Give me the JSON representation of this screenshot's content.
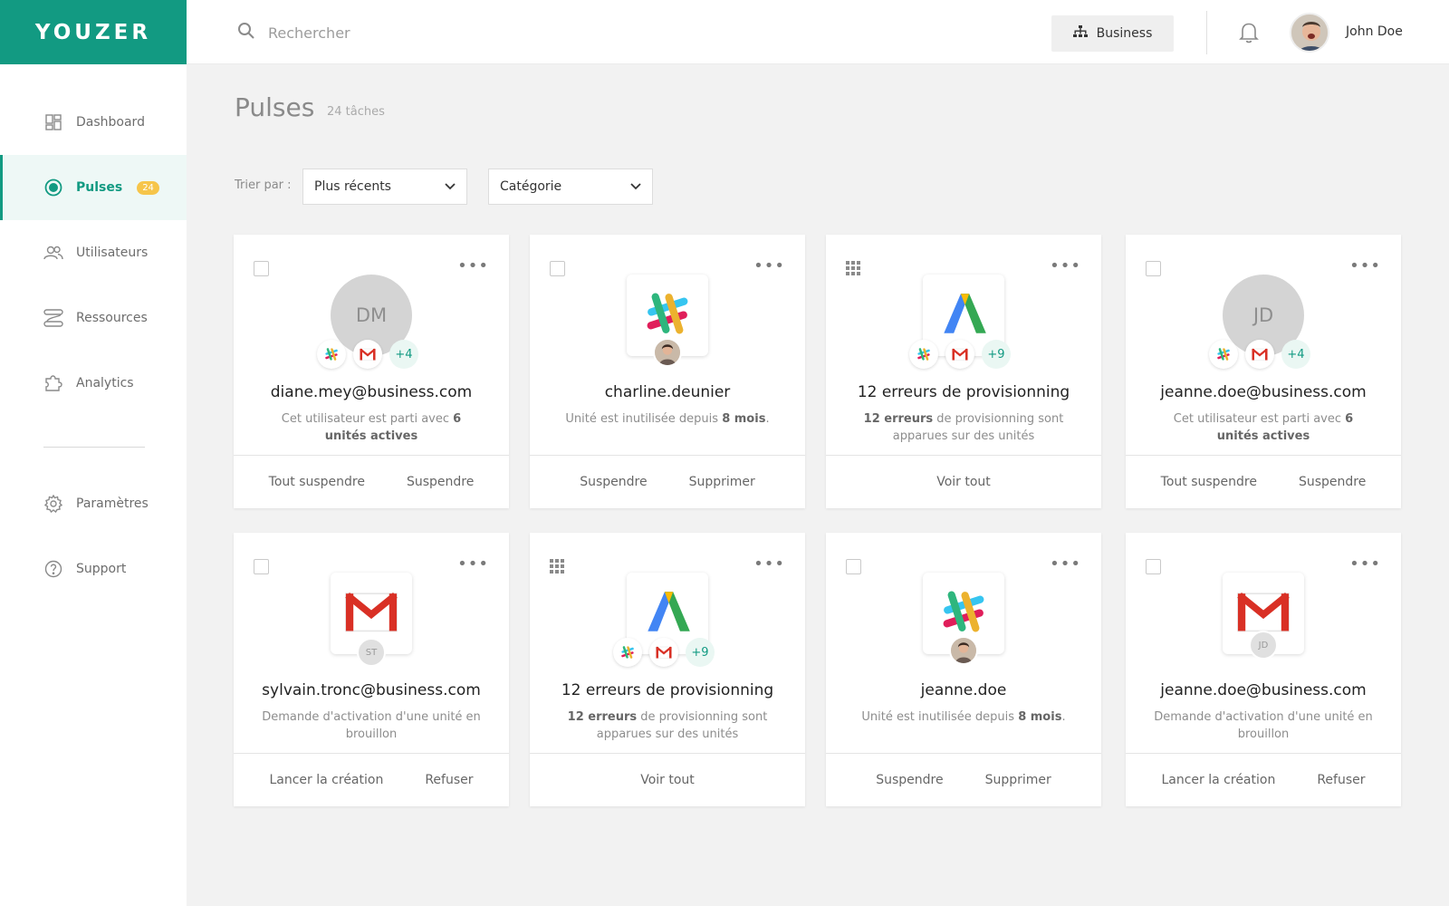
{
  "brand": {
    "name": "YOUZER",
    "color": "#129a82"
  },
  "sidebar": {
    "items": [
      {
        "label": "Dashboard",
        "icon": "dashboard-icon"
      },
      {
        "label": "Pulses",
        "icon": "pulse-icon",
        "badge": "24",
        "active": true
      },
      {
        "label": "Utilisateurs",
        "icon": "users-icon"
      },
      {
        "label": "Ressources",
        "icon": "resources-icon"
      },
      {
        "label": "Analytics",
        "icon": "puzzle-icon"
      },
      {
        "label": "Paramètres",
        "icon": "gear-icon"
      },
      {
        "label": "Support",
        "icon": "help-icon"
      }
    ]
  },
  "topbar": {
    "search_placeholder": "Rechercher",
    "business_label": "Business",
    "user_name": "John Doe"
  },
  "page": {
    "title": "Pulses",
    "count": "24 tâches",
    "sort_label": "Trier par :",
    "sort_value": "Plus récents",
    "category_value": "Catégorie"
  },
  "cards": [
    {
      "title": "diane.mey@business.com",
      "desc_pre": "Cet utilisateur est parti avec ",
      "desc_bold": "6 unités actives",
      "desc_post": "",
      "initials": "DM",
      "plus": "+4",
      "actions": [
        "Tout suspendre",
        "Suspendre"
      ]
    },
    {
      "title": "charline.deunier",
      "desc_pre": "Unité est inutilisée depuis ",
      "desc_bold": "8 mois",
      "desc_post": ".",
      "actions": [
        "Suspendre",
        "Supprimer"
      ]
    },
    {
      "title": "12 erreurs de provisionning",
      "desc_pre": "",
      "desc_bold": "12 erreurs",
      "desc_post": " de provisionning sont apparues sur des unités",
      "plus": "+9",
      "actions": [
        "Voir tout"
      ]
    },
    {
      "title": "jeanne.doe@business.com",
      "desc_pre": "Cet utilisateur est parti avec ",
      "desc_bold": "6 unités actives",
      "desc_post": "",
      "initials": "JD",
      "plus": "+4",
      "actions": [
        "Tout suspendre",
        "Suspendre"
      ]
    },
    {
      "title": "sylvain.tronc@business.com",
      "desc_pre": "Demande d'activation d'une unité en brouillon",
      "desc_bold": "",
      "desc_post": "",
      "owner": "ST",
      "actions": [
        "Lancer la création",
        "Refuser"
      ]
    },
    {
      "title": "12 erreurs de provisionning",
      "desc_pre": "",
      "desc_bold": "12 erreurs",
      "desc_post": " de provisionning sont apparues sur des unités",
      "plus": "+9",
      "actions": [
        "Voir tout"
      ]
    },
    {
      "title": "jeanne.doe",
      "desc_pre": "Unité est inutilisée depuis ",
      "desc_bold": "8 mois",
      "desc_post": ".",
      "actions": [
        "Suspendre",
        "Supprimer"
      ]
    },
    {
      "title": "jeanne.doe@business.com",
      "desc_pre": "Demande d'activation d'une unité en brouillon",
      "desc_bold": "",
      "desc_post": "",
      "owner": "JD",
      "actions": [
        "Lancer la création",
        "Refuser"
      ]
    }
  ]
}
